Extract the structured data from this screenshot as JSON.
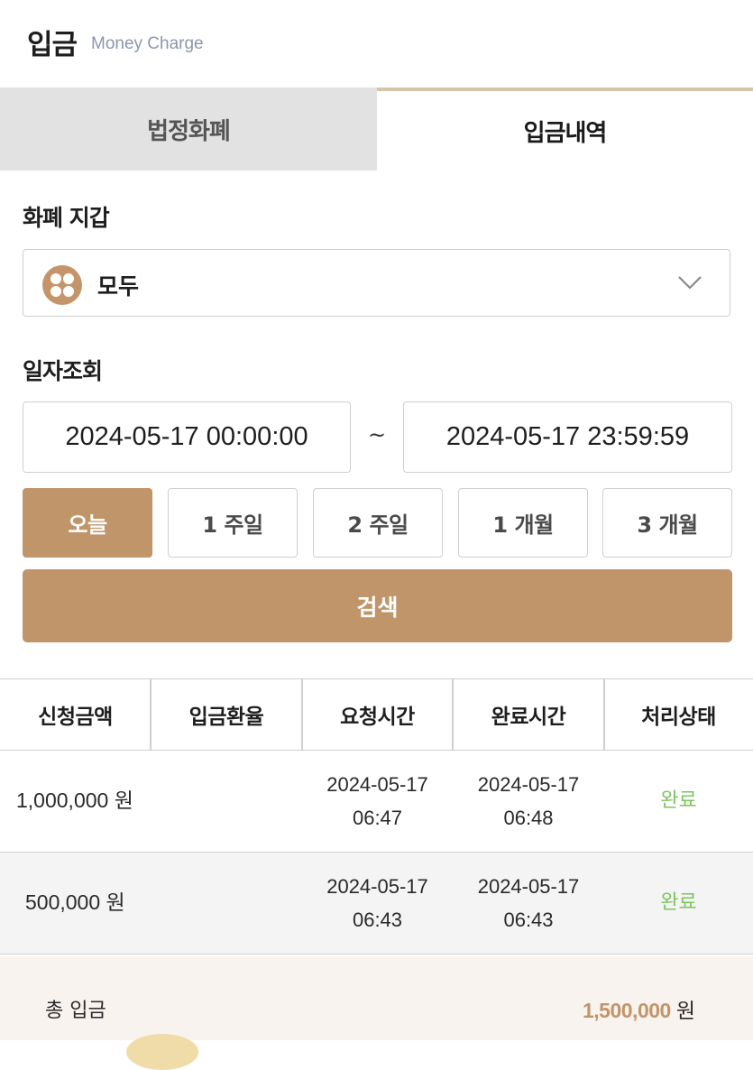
{
  "header": {
    "title": "입금",
    "subtitle": "Money Charge"
  },
  "tabs": [
    {
      "label": "법정화폐",
      "active": false
    },
    {
      "label": "입금내역",
      "active": true
    }
  ],
  "wallet": {
    "label": "화폐 지갑",
    "selected": "모두",
    "icon": "coin-grid-icon"
  },
  "date_query": {
    "label": "일자조회",
    "from": "2024-05-17 00:00:00",
    "separator": "~",
    "to": "2024-05-17 23:59:59"
  },
  "periods": [
    {
      "label": "오늘",
      "selected": true
    },
    {
      "label": "1 주일",
      "selected": false
    },
    {
      "label": "2 주일",
      "selected": false
    },
    {
      "label": "1 개월",
      "selected": false
    },
    {
      "label": "3 개월",
      "selected": false
    }
  ],
  "search_label": "검색",
  "table": {
    "columns": [
      "신청금액",
      "입금환율",
      "요청시간",
      "완료시간",
      "처리상태"
    ],
    "rows": [
      {
        "amount": "1,000,000 원",
        "rate": "",
        "request_date": "2024-05-17",
        "request_time": "06:47",
        "complete_date": "2024-05-17",
        "complete_time": "06:48",
        "status": "완료"
      },
      {
        "amount": "500,000 원",
        "rate": "",
        "request_date": "2024-05-17",
        "request_time": "06:43",
        "complete_date": "2024-05-17",
        "complete_time": "06:43",
        "status": "완료"
      }
    ]
  },
  "total": {
    "label": "총 입금",
    "amount": "1,500,000",
    "unit": "원"
  },
  "colors": {
    "accent": "#c1956a",
    "status_done": "#7dc560",
    "tab_inactive_bg": "#e2e2e2"
  }
}
